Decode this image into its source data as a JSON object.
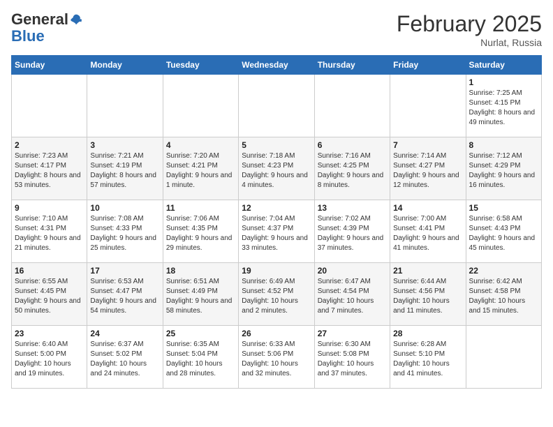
{
  "header": {
    "logo_general": "General",
    "logo_blue": "Blue",
    "month_title": "February 2025",
    "location": "Nurlat, Russia"
  },
  "weekdays": [
    "Sunday",
    "Monday",
    "Tuesday",
    "Wednesday",
    "Thursday",
    "Friday",
    "Saturday"
  ],
  "weeks": [
    [
      {
        "day": "",
        "info": ""
      },
      {
        "day": "",
        "info": ""
      },
      {
        "day": "",
        "info": ""
      },
      {
        "day": "",
        "info": ""
      },
      {
        "day": "",
        "info": ""
      },
      {
        "day": "",
        "info": ""
      },
      {
        "day": "1",
        "info": "Sunrise: 7:25 AM\nSunset: 4:15 PM\nDaylight: 8 hours and 49 minutes."
      }
    ],
    [
      {
        "day": "2",
        "info": "Sunrise: 7:23 AM\nSunset: 4:17 PM\nDaylight: 8 hours and 53 minutes."
      },
      {
        "day": "3",
        "info": "Sunrise: 7:21 AM\nSunset: 4:19 PM\nDaylight: 8 hours and 57 minutes."
      },
      {
        "day": "4",
        "info": "Sunrise: 7:20 AM\nSunset: 4:21 PM\nDaylight: 9 hours and 1 minute."
      },
      {
        "day": "5",
        "info": "Sunrise: 7:18 AM\nSunset: 4:23 PM\nDaylight: 9 hours and 4 minutes."
      },
      {
        "day": "6",
        "info": "Sunrise: 7:16 AM\nSunset: 4:25 PM\nDaylight: 9 hours and 8 minutes."
      },
      {
        "day": "7",
        "info": "Sunrise: 7:14 AM\nSunset: 4:27 PM\nDaylight: 9 hours and 12 minutes."
      },
      {
        "day": "8",
        "info": "Sunrise: 7:12 AM\nSunset: 4:29 PM\nDaylight: 9 hours and 16 minutes."
      }
    ],
    [
      {
        "day": "9",
        "info": "Sunrise: 7:10 AM\nSunset: 4:31 PM\nDaylight: 9 hours and 21 minutes."
      },
      {
        "day": "10",
        "info": "Sunrise: 7:08 AM\nSunset: 4:33 PM\nDaylight: 9 hours and 25 minutes."
      },
      {
        "day": "11",
        "info": "Sunrise: 7:06 AM\nSunset: 4:35 PM\nDaylight: 9 hours and 29 minutes."
      },
      {
        "day": "12",
        "info": "Sunrise: 7:04 AM\nSunset: 4:37 PM\nDaylight: 9 hours and 33 minutes."
      },
      {
        "day": "13",
        "info": "Sunrise: 7:02 AM\nSunset: 4:39 PM\nDaylight: 9 hours and 37 minutes."
      },
      {
        "day": "14",
        "info": "Sunrise: 7:00 AM\nSunset: 4:41 PM\nDaylight: 9 hours and 41 minutes."
      },
      {
        "day": "15",
        "info": "Sunrise: 6:58 AM\nSunset: 4:43 PM\nDaylight: 9 hours and 45 minutes."
      }
    ],
    [
      {
        "day": "16",
        "info": "Sunrise: 6:55 AM\nSunset: 4:45 PM\nDaylight: 9 hours and 50 minutes."
      },
      {
        "day": "17",
        "info": "Sunrise: 6:53 AM\nSunset: 4:47 PM\nDaylight: 9 hours and 54 minutes."
      },
      {
        "day": "18",
        "info": "Sunrise: 6:51 AM\nSunset: 4:49 PM\nDaylight: 9 hours and 58 minutes."
      },
      {
        "day": "19",
        "info": "Sunrise: 6:49 AM\nSunset: 4:52 PM\nDaylight: 10 hours and 2 minutes."
      },
      {
        "day": "20",
        "info": "Sunrise: 6:47 AM\nSunset: 4:54 PM\nDaylight: 10 hours and 7 minutes."
      },
      {
        "day": "21",
        "info": "Sunrise: 6:44 AM\nSunset: 4:56 PM\nDaylight: 10 hours and 11 minutes."
      },
      {
        "day": "22",
        "info": "Sunrise: 6:42 AM\nSunset: 4:58 PM\nDaylight: 10 hours and 15 minutes."
      }
    ],
    [
      {
        "day": "23",
        "info": "Sunrise: 6:40 AM\nSunset: 5:00 PM\nDaylight: 10 hours and 19 minutes."
      },
      {
        "day": "24",
        "info": "Sunrise: 6:37 AM\nSunset: 5:02 PM\nDaylight: 10 hours and 24 minutes."
      },
      {
        "day": "25",
        "info": "Sunrise: 6:35 AM\nSunset: 5:04 PM\nDaylight: 10 hours and 28 minutes."
      },
      {
        "day": "26",
        "info": "Sunrise: 6:33 AM\nSunset: 5:06 PM\nDaylight: 10 hours and 32 minutes."
      },
      {
        "day": "27",
        "info": "Sunrise: 6:30 AM\nSunset: 5:08 PM\nDaylight: 10 hours and 37 minutes."
      },
      {
        "day": "28",
        "info": "Sunrise: 6:28 AM\nSunset: 5:10 PM\nDaylight: 10 hours and 41 minutes."
      },
      {
        "day": "",
        "info": ""
      }
    ]
  ]
}
